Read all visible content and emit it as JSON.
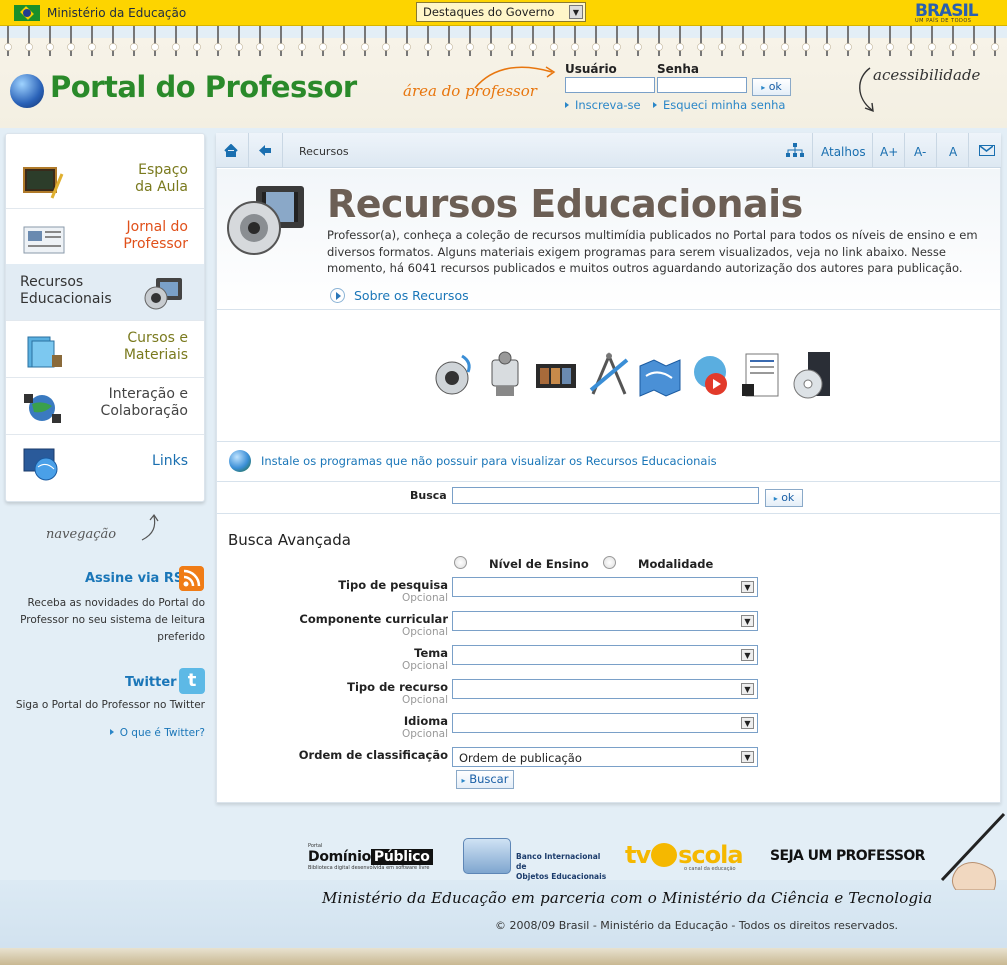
{
  "gov_bar": {
    "ministry": "Ministério da Educação",
    "dropdown": "Destaques do Governo",
    "brand": "BRASIL",
    "brand_sub": "UM PAÍS DE TODOS"
  },
  "header": {
    "logo": "Portal do Professor",
    "area": "área do professor",
    "user_label": "Usuário",
    "password_label": "Senha",
    "ok": "ok",
    "register": "Inscreva-se",
    "forgot": "Esqueci minha senha",
    "accessibility": "acessibilidade"
  },
  "sidebar": {
    "items": [
      {
        "label1": "Espaço",
        "label2": "da Aula",
        "color": "#7a7a1e",
        "icon": "blackboard-icon"
      },
      {
        "label1": "Jornal do",
        "label2": "Professor",
        "color": "#e0501a",
        "icon": "newspaper-icon"
      },
      {
        "label1": "Recursos",
        "label2": "Educacionais",
        "color": "#333333",
        "icon": "speaker-film-icon",
        "active": true
      },
      {
        "label1": "Cursos e",
        "label2": "Materiais",
        "color": "#7a7a1e",
        "icon": "books-icon"
      },
      {
        "label1": "Interação e",
        "label2": "Colaboração",
        "color": "#444444",
        "icon": "network-globe-icon"
      },
      {
        "label1": "Links",
        "label2": "",
        "color": "#1a6fb0",
        "icon": "monitor-globe-icon"
      }
    ],
    "nav_caption": "navegação",
    "rss_title": "Assine via RSS",
    "rss_desc1": "Receba as novidades do Portal do",
    "rss_desc2": "Professor no seu sistema de leitura",
    "rss_desc3": "preferido",
    "twitter_title": "Twitter",
    "twitter_desc": "Siga o Portal do Professor no Twitter",
    "twitter_link": "O que é Twitter?"
  },
  "toolbar": {
    "breadcrumb": "Recursos",
    "atalhos": "Atalhos",
    "font_bigger": "A+",
    "font_smaller": "A-",
    "font_default": "A"
  },
  "main": {
    "title": "Recursos Educacionais",
    "intro1": "Professor(a), conheça a coleção de recursos multimídia publicados no Portal para todos os níveis de ensino e em",
    "intro2": "diversos formatos. Alguns materiais exigem programas para serem visualizados, veja no link abaixo. Nesse",
    "intro3": "momento, há 6041 recursos publicados e muitos outros aguardando autorização dos autores para publicação.",
    "about": "Sobre os Recursos",
    "media_icons": [
      "audio-icon",
      "video-camera-icon",
      "film-icon",
      "drawing-tools-icon",
      "map-icon",
      "multimedia-icon",
      "document-icon",
      "software-icon"
    ],
    "install": "Instale os programas que não possuir para visualizar os Recursos Educacionais",
    "search_label": "Busca",
    "search_value": "",
    "search_ok": "ok",
    "advanced_title": "Busca Avançada",
    "radio_level": "Nível de Ensino",
    "radio_modality": "Modalidade",
    "fields": [
      {
        "label": "Tipo de pesquisa",
        "hint": "Opcional",
        "value": ""
      },
      {
        "label": "Componente curricular",
        "hint": "Opcional",
        "value": ""
      },
      {
        "label": "Tema",
        "hint": "Opcional",
        "value": ""
      },
      {
        "label": "Tipo de recurso",
        "hint": "Opcional",
        "value": ""
      },
      {
        "label": "Idioma",
        "hint": "Opcional",
        "value": ""
      },
      {
        "label": "Ordem de classificação",
        "hint": "",
        "value": "Ordem de publicação"
      }
    ],
    "search_button": "Buscar"
  },
  "footer": {
    "dominio_small": "Portal",
    "dominio1": "Domínio",
    "dominio2": "Público",
    "dominio_sub": "Biblioteca digital desenvolvida em software livre",
    "bioe1": "Banco Internacional de",
    "bioe2": "Objetos Educacionais",
    "tv_left": "tv",
    "tv_right": "scola",
    "tv_sub": "o canal da educação",
    "seja": "SEJA UM PROFESSOR",
    "partnership": "Ministério da Educação em parceria com o Ministério da Ciência e Tecnologia",
    "copyright": "© 2008/09 Brasil - Ministério da Educação - Todos os direitos reservados."
  }
}
